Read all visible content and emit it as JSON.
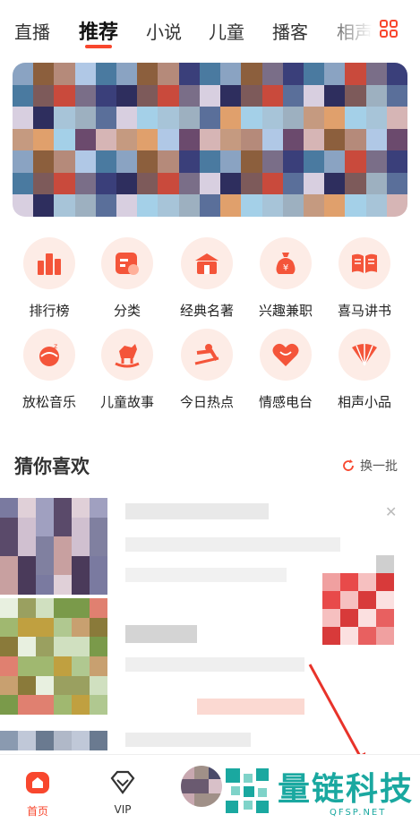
{
  "tabs": [
    {
      "label": "直播"
    },
    {
      "label": "推荐",
      "active": true
    },
    {
      "label": "小说"
    },
    {
      "label": "儿童"
    },
    {
      "label": "播客"
    },
    {
      "label": "相声"
    }
  ],
  "categories": [
    {
      "label": "排行榜",
      "icon": "ranking-icon"
    },
    {
      "label": "分类",
      "icon": "category-icon"
    },
    {
      "label": "经典名著",
      "icon": "classic-icon"
    },
    {
      "label": "兴趣兼职",
      "icon": "money-bag-icon"
    },
    {
      "label": "喜马讲书",
      "icon": "book-icon"
    },
    {
      "label": "放松音乐",
      "icon": "relax-music-icon"
    },
    {
      "label": "儿童故事",
      "icon": "rocking-horse-icon"
    },
    {
      "label": "今日热点",
      "icon": "hot-news-icon"
    },
    {
      "label": "情感电台",
      "icon": "heart-icon"
    },
    {
      "label": "相声小品",
      "icon": "fan-icon"
    }
  ],
  "section": {
    "title": "猜你喜欢",
    "refresh_label": "换一批"
  },
  "bottom_nav": {
    "home_label": "首页",
    "vip_label": "VIP"
  },
  "watermark": {
    "text": "量链科技",
    "sub": "QFSP.NET"
  },
  "colors": {
    "accent": "#f8472e",
    "watermark": "#1aa8a0"
  }
}
